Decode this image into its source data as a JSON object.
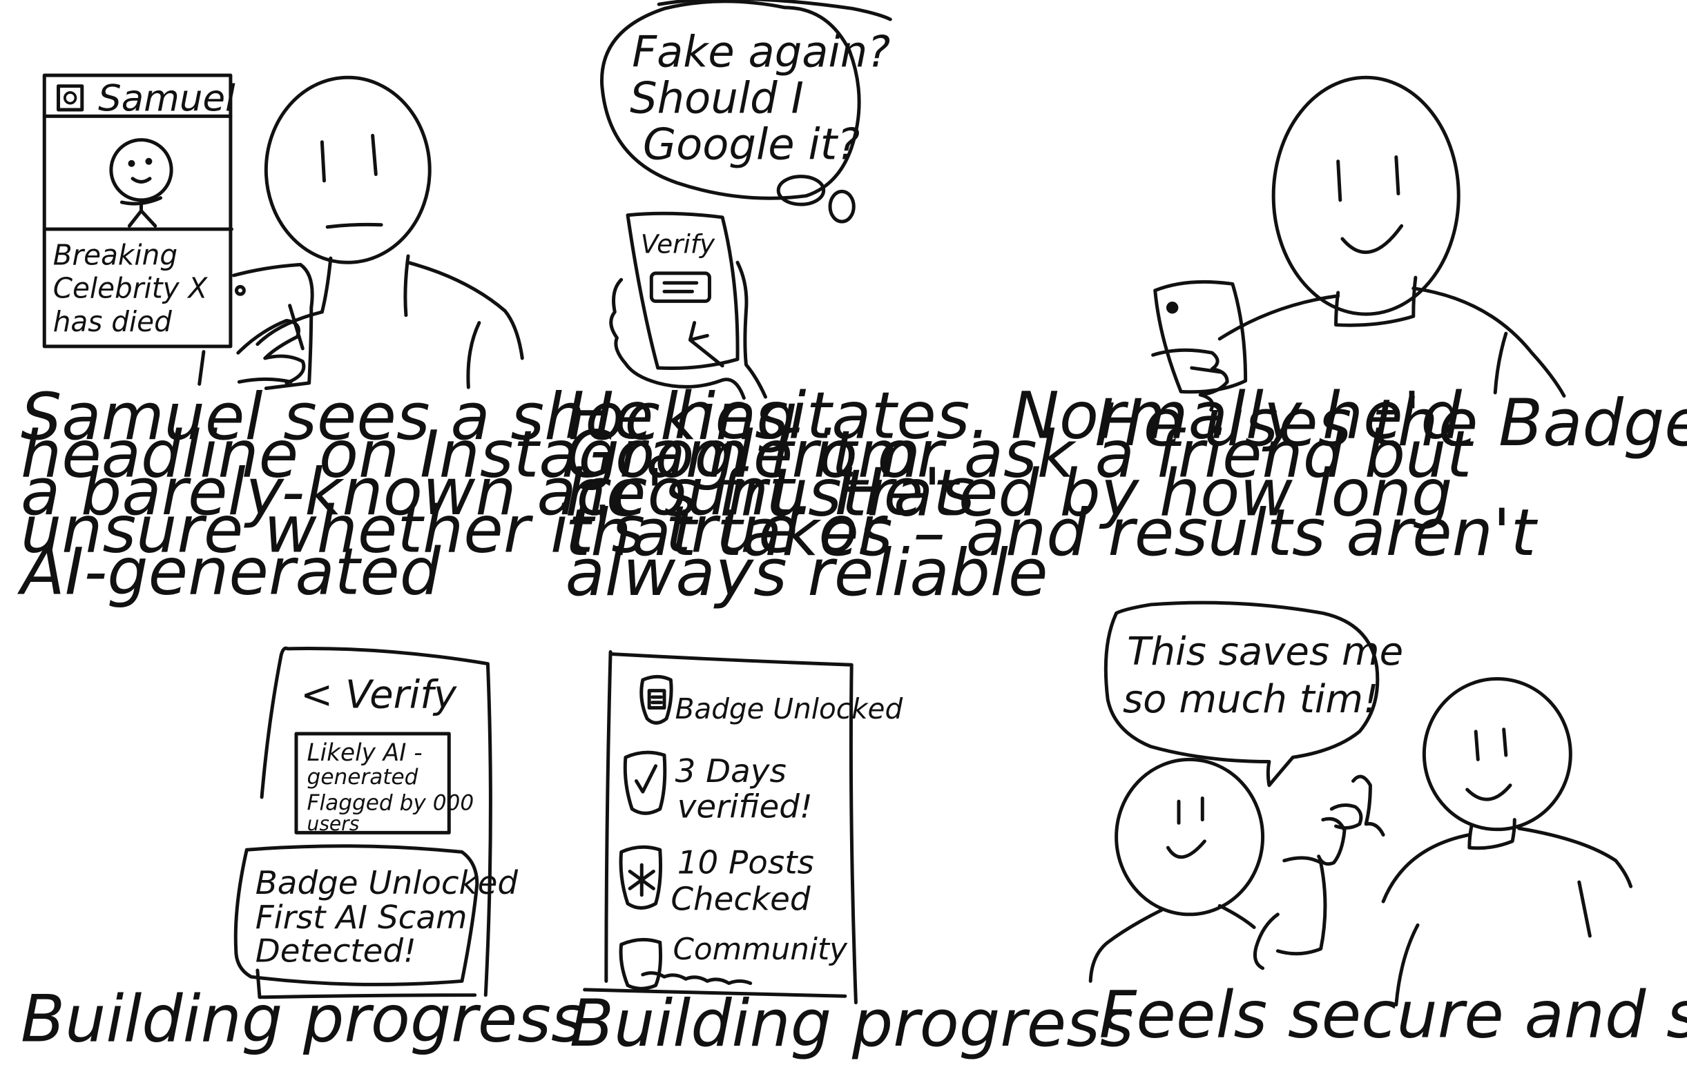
{
  "panels": [
    {
      "phone_post": {
        "account": "Samuel",
        "headline_lines": [
          "Breaking",
          "Celebrity X",
          "has died"
        ]
      },
      "caption_lines": [
        "Samuel sees a shocking",
        "headline on Instagram from",
        "a barely-known account. He's",
        "unsure whether it's true or",
        "AI-generated"
      ]
    },
    {
      "thought_lines": [
        "Fake again?",
        "Should I",
        "Google it?"
      ],
      "phone_label": "Verify",
      "caption_lines": [
        "He hesitates. Normally he'd",
        "Google it or ask a friend but",
        "he's frustrated by how long",
        "that takes – and results aren't",
        "always reliable"
      ]
    },
    {
      "caption_lines": [
        "He uses the Badge system"
      ]
    },
    {
      "screen_title": "< Verify",
      "result_lines": [
        "Likely AI -",
        "generated",
        "Flagged by 000",
        "users"
      ],
      "badge_lines": [
        "Badge Unlocked",
        "First AI Scam",
        "Detected!"
      ],
      "caption_lines": [
        "Building progress"
      ]
    },
    {
      "badges": [
        {
          "icon": "shield-badge-icon",
          "lines": [
            "Badge Unlocked"
          ]
        },
        {
          "icon": "shield-check-icon",
          "lines": [
            "3 Days",
            "verified!"
          ]
        },
        {
          "icon": "shield-star-icon",
          "lines": [
            "10 Posts",
            "Checked"
          ]
        },
        {
          "icon": "shield-community-icon",
          "lines": [
            "Community"
          ]
        }
      ],
      "caption_lines": [
        "Building progress"
      ]
    },
    {
      "speech_lines": [
        "This saves me",
        "so much tim!"
      ],
      "caption_lines": [
        "Feels secure and shares tool"
      ]
    }
  ]
}
